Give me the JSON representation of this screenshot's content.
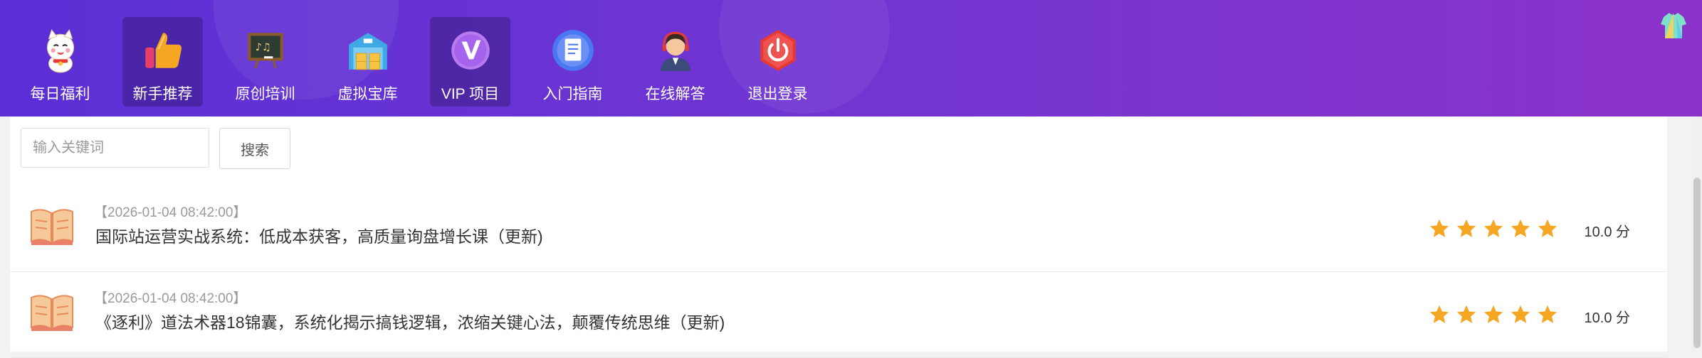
{
  "nav": {
    "items": [
      {
        "label": "每日福利",
        "icon": "lucky-cat-icon",
        "active": false
      },
      {
        "label": "新手推荐",
        "icon": "thumbs-up-icon",
        "active": true
      },
      {
        "label": "原创培训",
        "icon": "blackboard-icon",
        "active": false
      },
      {
        "label": "虚拟宝库",
        "icon": "warehouse-icon",
        "active": false
      },
      {
        "label": "VIP 项目",
        "icon": "vip-icon",
        "active": true
      },
      {
        "label": "入门指南",
        "icon": "guide-document-icon",
        "active": false
      },
      {
        "label": "在线解答",
        "icon": "support-agent-icon",
        "active": false
      },
      {
        "label": "退出登录",
        "icon": "power-icon",
        "active": false
      }
    ]
  },
  "search": {
    "placeholder": "输入关键词",
    "button_label": "搜索"
  },
  "items": [
    {
      "date": "【2026-01-04 08:42:00】",
      "title": "国际站运营实战系统：低成本获客，高质量询盘增长课（更新)",
      "rating": 5,
      "score": "10.0 分"
    },
    {
      "date": "【2026-01-04 08:42:00】",
      "title": "《逐利》道法术器18锦囊，系统化揭示搞钱逻辑，浓缩关键心法，颠覆传统思维（更新)",
      "rating": 5,
      "score": "10.0 分"
    }
  ],
  "colors": {
    "header_start": "#5b2fd6",
    "header_end": "#8b32c9",
    "star": "#f5a623"
  }
}
